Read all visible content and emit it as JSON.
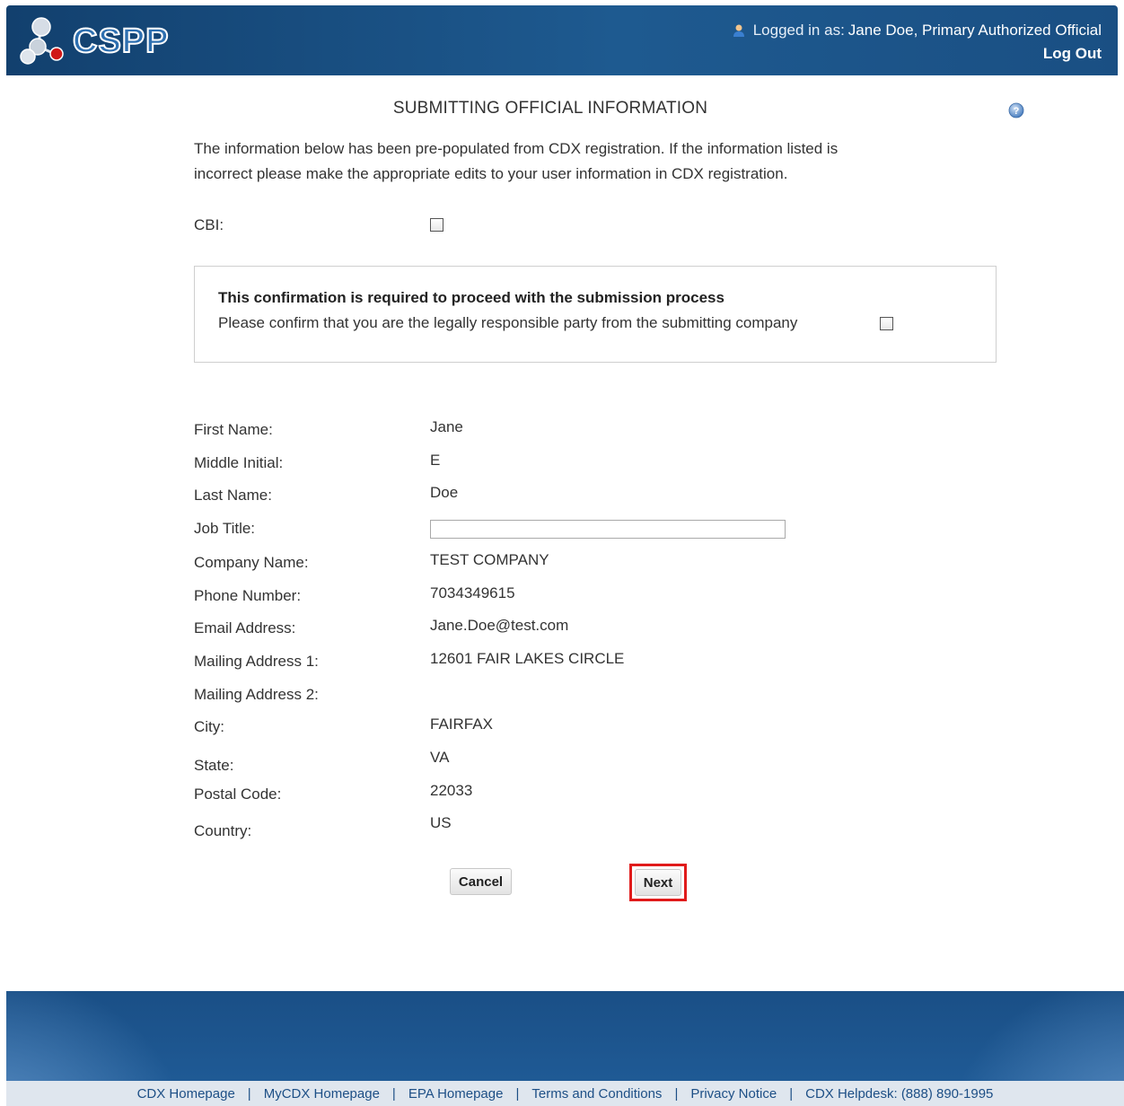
{
  "header": {
    "logo_text": "CSPP",
    "logged_in_prefix": "Logged in as:",
    "user_name": "Jane Doe, Primary Authorized Official",
    "logout_label": "Log Out"
  },
  "page": {
    "title": "SUBMITTING OFFICIAL INFORMATION",
    "intro_line1": "The information below has been pre-populated from CDX registration. If the information listed is",
    "intro_line2": "incorrect please make the appropriate edits to your user information in CDX registration.",
    "cbi_label": "CBI:"
  },
  "confirmation": {
    "title": "This confirmation is required to proceed with the submission process",
    "text": "Please confirm that you are the legally responsible party from the submitting company"
  },
  "fields": {
    "first_name": {
      "label": "First Name:",
      "value": "Jane"
    },
    "middle_initial": {
      "label": "Middle Initial:",
      "value": "E"
    },
    "last_name": {
      "label": "Last Name:",
      "value": "Doe"
    },
    "job_title": {
      "label": "Job Title:",
      "value": ""
    },
    "company_name": {
      "label": "Company Name:",
      "value": "TEST COMPANY"
    },
    "phone_number": {
      "label": "Phone Number:",
      "value": "7034349615"
    },
    "email_address": {
      "label": "Email Address:",
      "value": "Jane.Doe@test.com"
    },
    "mailing_address_1": {
      "label": "Mailing Address 1:",
      "value": "12601 FAIR LAKES CIRCLE"
    },
    "mailing_address_2": {
      "label": "Mailing Address 2:",
      "value": ""
    },
    "city": {
      "label": "City:",
      "value": "FAIRFAX"
    },
    "state": {
      "label": "State:",
      "value": "VA"
    },
    "postal_code": {
      "label": "Postal Code:",
      "value": "22033"
    },
    "country": {
      "label": "Country:",
      "value": "US"
    }
  },
  "buttons": {
    "cancel": "Cancel",
    "next": "Next"
  },
  "footer": {
    "links": [
      "CDX Homepage",
      "MyCDX Homepage",
      "EPA Homepage",
      "Terms and Conditions",
      "Privacy Notice",
      "CDX Helpdesk: (888) 890-1995"
    ],
    "separator": "|"
  },
  "colors": {
    "header_bg": "#1e5a90",
    "footer_bg": "#1f5a95",
    "next_highlight": "#e01b1b"
  },
  "icons": {
    "logo": "molecule-logo-icon",
    "user": "user-icon",
    "help": "help-icon"
  }
}
